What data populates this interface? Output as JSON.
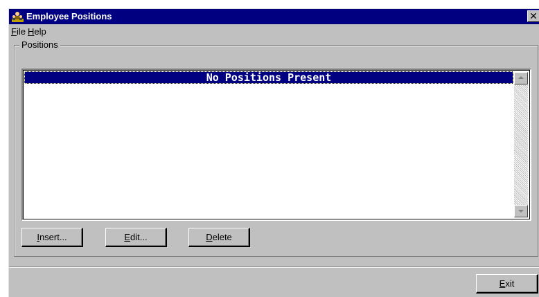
{
  "window": {
    "title": "Employee Positions",
    "close_glyph": "✕"
  },
  "menu": [
    {
      "first": "F",
      "rest": "ile"
    },
    {
      "first": "H",
      "rest": "elp"
    }
  ],
  "positions": {
    "group_label": "Positions",
    "list_items": [
      "No Positions Present"
    ],
    "selected_index": 0
  },
  "buttons": {
    "insert": {
      "first": "I",
      "rest": "nsert..."
    },
    "edit": {
      "first": "E",
      "rest": "dit..."
    },
    "delete": {
      "first": "D",
      "rest": "elete"
    },
    "exit": {
      "first": "E",
      "rest": "xit"
    }
  },
  "colors": {
    "titlebar": "#000080",
    "window_face": "#c0c0c0",
    "selection": "#000080"
  },
  "icons": {
    "app": "employee-app-icon",
    "close": "close-icon",
    "scroll_up": "scroll-up-arrow-icon",
    "scroll_down": "scroll-down-arrow-icon"
  }
}
